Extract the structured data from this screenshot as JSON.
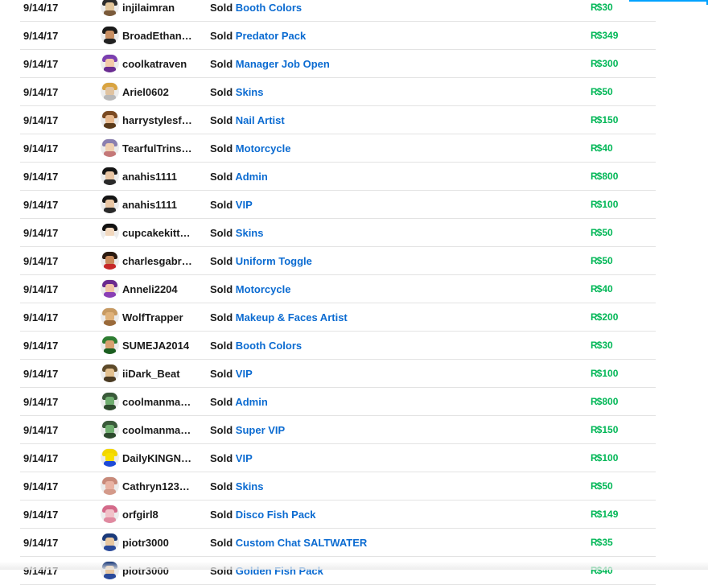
{
  "currency_symbol": "R$",
  "rows": [
    {
      "date": "9/14/17",
      "user": "injilaimran",
      "action": "Sold",
      "item": "Booth Colors",
      "amount": "30",
      "avatar": {
        "hair": "#2b2b2b",
        "face": "#e2c59a",
        "shirt": "#7a5a3a"
      }
    },
    {
      "date": "9/14/17",
      "user": "BroadEthan…",
      "action": "Sold",
      "item": "Predator Pack",
      "amount": "349",
      "avatar": {
        "hair": "#1a1a1a",
        "face": "#c98f62",
        "shirt": "#222222"
      }
    },
    {
      "date": "9/14/17",
      "user": "coolkatraven",
      "action": "Sold",
      "item": "Manager Job Open",
      "amount": "300",
      "avatar": {
        "hair": "#7b3fb0",
        "face": "#f3c9a8",
        "shirt": "#6a2c91"
      }
    },
    {
      "date": "9/14/17",
      "user": "Ariel0602",
      "action": "Sold",
      "item": "Skins",
      "amount": "50",
      "avatar": {
        "hair": "#d9a441",
        "face": "#e0c3a0",
        "shirt": "#b8b8b8"
      }
    },
    {
      "date": "9/14/17",
      "user": "harrystylesf…",
      "action": "Sold",
      "item": "Nail Artist",
      "amount": "150",
      "avatar": {
        "hair": "#7a4a22",
        "face": "#e8b98e",
        "shirt": "#5a3a1a"
      }
    },
    {
      "date": "9/14/17",
      "user": "TearfulTrins…",
      "action": "Sold",
      "item": "Motorcycle",
      "amount": "40",
      "avatar": {
        "hair": "#8a7fb0",
        "face": "#f0d0b0",
        "shirt": "#c47878"
      }
    },
    {
      "date": "9/14/17",
      "user": "anahis1111",
      "action": "Sold",
      "item": "Admin",
      "amount": "800",
      "avatar": {
        "hair": "#151515",
        "face": "#e9c6a4",
        "shirt": "#2a2a2a"
      }
    },
    {
      "date": "9/14/17",
      "user": "anahis1111",
      "action": "Sold",
      "item": "VIP",
      "amount": "100",
      "avatar": {
        "hair": "#151515",
        "face": "#e9c6a4",
        "shirt": "#2a2a2a"
      }
    },
    {
      "date": "9/14/17",
      "user": "cupcakekitt…",
      "action": "Sold",
      "item": "Skins",
      "amount": "50",
      "avatar": {
        "hair": "#111111",
        "face": "#f1d7bd",
        "shirt": "#ffffff"
      }
    },
    {
      "date": "9/14/17",
      "user": "charlesgabr…",
      "action": "Sold",
      "item": "Uniform Toggle",
      "amount": "50",
      "avatar": {
        "hair": "#2a1a10",
        "face": "#c98a5b",
        "shirt": "#c62828"
      }
    },
    {
      "date": "9/14/17",
      "user": "Anneli2204",
      "action": "Sold",
      "item": "Motorcycle",
      "amount": "40",
      "avatar": {
        "hair": "#6b2a8f",
        "face": "#f2c4a6",
        "shirt": "#8a3fb5"
      }
    },
    {
      "date": "9/14/17",
      "user": "WolfTrapper",
      "action": "Sold",
      "item": "Makeup & Faces Artist",
      "amount": "200",
      "avatar": {
        "hair": "#c79a62",
        "face": "#e0b27a",
        "shirt": "#9a6a3a"
      }
    },
    {
      "date": "9/14/17",
      "user": "SUMEJA2014",
      "action": "Sold",
      "item": "Booth Colors",
      "amount": "30",
      "avatar": {
        "hair": "#2e7d32",
        "face": "#d9a070",
        "shirt": "#1b5e20"
      }
    },
    {
      "date": "9/14/17",
      "user": "iiDark_Beat",
      "action": "Sold",
      "item": "VIP",
      "amount": "100",
      "avatar": {
        "hair": "#5d4a2a",
        "face": "#e3c08f",
        "shirt": "#4a3a22"
      }
    },
    {
      "date": "9/14/17",
      "user": "coolmanma…",
      "action": "Sold",
      "item": "Admin",
      "amount": "800",
      "avatar": {
        "hair": "#3a5a3a",
        "face": "#6fae6f",
        "shirt": "#2d4a2d"
      }
    },
    {
      "date": "9/14/17",
      "user": "coolmanma…",
      "action": "Sold",
      "item": "Super VIP",
      "amount": "150",
      "avatar": {
        "hair": "#3a5a3a",
        "face": "#6fae6f",
        "shirt": "#2d4a2d"
      }
    },
    {
      "date": "9/14/17",
      "user": "DailyKINGN…",
      "action": "Sold",
      "item": "VIP",
      "amount": "100",
      "avatar": {
        "hair": "#f2d600",
        "face": "#f7e000",
        "shirt": "#1e4bd8"
      }
    },
    {
      "date": "9/14/17",
      "user": "Cathryn123…",
      "action": "Sold",
      "item": "Skins",
      "amount": "50",
      "avatar": {
        "hair": "#c88a7a",
        "face": "#e9b3a3",
        "shirt": "#d49a8a"
      }
    },
    {
      "date": "9/14/17",
      "user": "orfgirl8",
      "action": "Sold",
      "item": "Disco Fish Pack",
      "amount": "149",
      "avatar": {
        "hair": "#d46a8a",
        "face": "#f1c1c8",
        "shirt": "#e08aa0"
      }
    },
    {
      "date": "9/14/17",
      "user": "piotr3000",
      "action": "Sold",
      "item": "Custom Chat SALTWATER",
      "amount": "35",
      "avatar": {
        "hair": "#1a3a7a",
        "face": "#e8c7a0",
        "shirt": "#2a4a9a"
      }
    },
    {
      "date": "9/14/17",
      "user": "piotr3000",
      "action": "Sold",
      "item": "Golden Fish Pack",
      "amount": "40",
      "avatar": {
        "hair": "#1a3a7a",
        "face": "#e8c7a0",
        "shirt": "#2a4a9a"
      }
    }
  ]
}
